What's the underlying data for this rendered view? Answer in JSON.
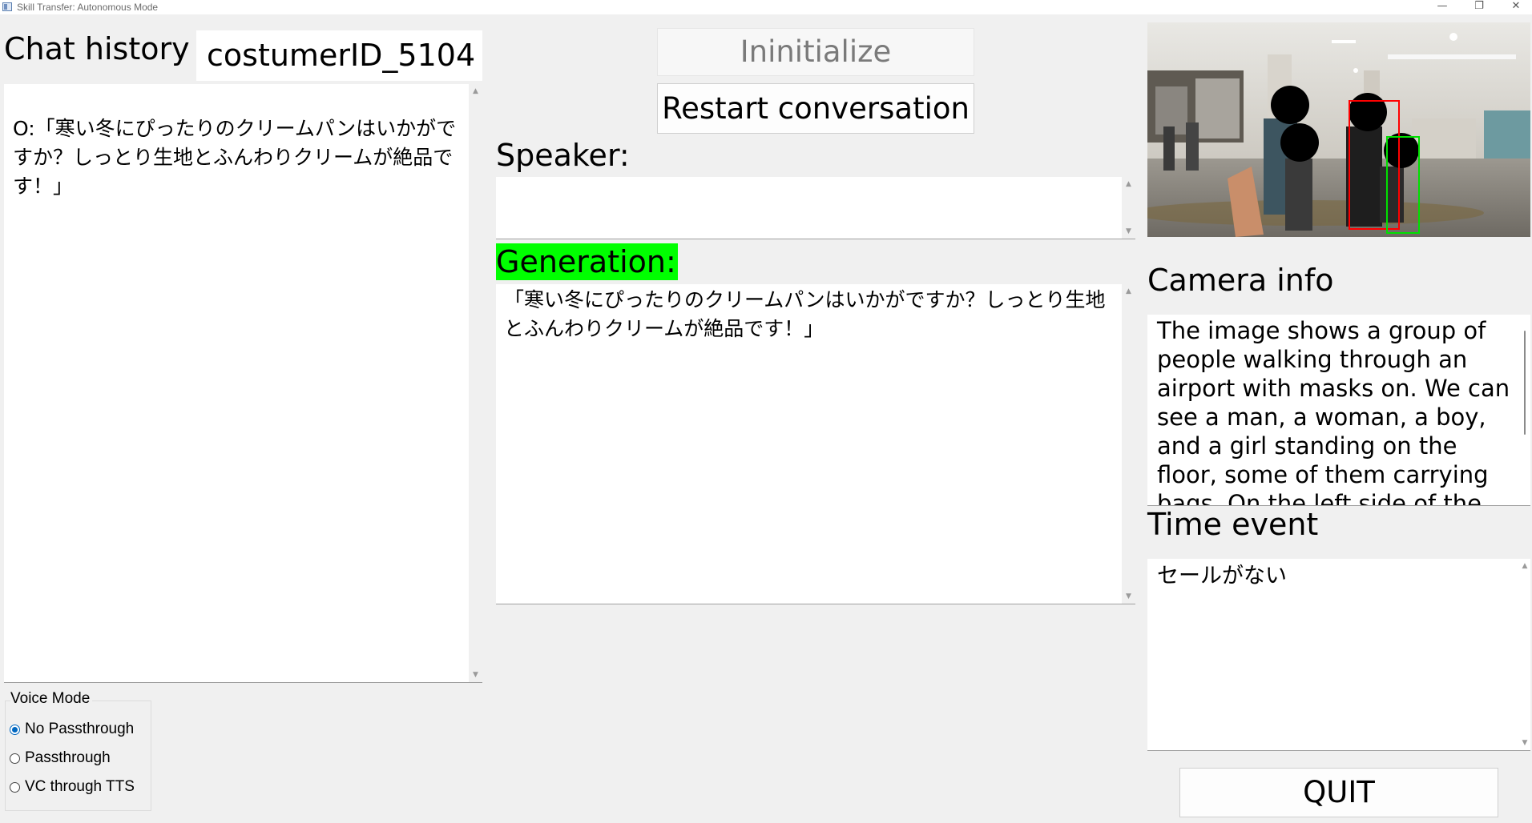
{
  "window": {
    "title": "Skill Transfer: Autonomous Mode",
    "minimize_glyph": "—",
    "maximize_glyph": "❐",
    "close_glyph": "✕"
  },
  "chat": {
    "heading": "Chat history",
    "customer_id": "costumerID_5104",
    "history_text": "O:「寒い冬にぴったりのクリームパンはいかがですか？しっとり生地とふんわりクリームが絶品です！」"
  },
  "controls": {
    "initialize_label": "Ininitialize",
    "restart_label": "Restart conversation",
    "quit_label": "QUIT"
  },
  "speaker": {
    "heading": "Speaker:",
    "text": ""
  },
  "generation": {
    "heading": "Generation:",
    "highlight_color": "#00ff00",
    "text": "「寒い冬にぴったりのクリームパンはいかがですか？しっとり生地とふんわりクリームが絶品です！」"
  },
  "camera": {
    "heading": "Camera info",
    "description": "The image shows a group of people walking through an airport with masks on. We can see a man, a woman, a boy, and a girl standing on the floor, some of them carrying bags. On the left side of the image"
  },
  "time_event": {
    "heading": "Time event",
    "text": "セールがない"
  },
  "voice_mode": {
    "heading": "Voice Mode",
    "options": [
      {
        "label": "No Passthrough",
        "checked": true
      },
      {
        "label": "Passthrough",
        "checked": false
      },
      {
        "label": "VC through TTS",
        "checked": false
      }
    ],
    "accent_color": "#0067c0"
  },
  "scroll_glyphs": {
    "up": "▲",
    "down": "▼"
  }
}
